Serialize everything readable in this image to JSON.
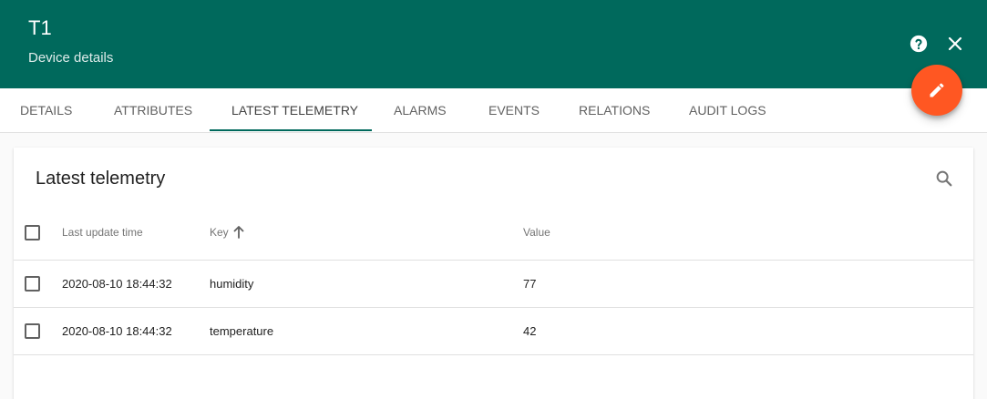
{
  "header": {
    "title": "T1",
    "subtitle": "Device details",
    "help_icon": "help-circle-icon",
    "close_icon": "close-icon",
    "background": "#00695c"
  },
  "fab": {
    "icon": "pencil-icon",
    "color": "#ff5722"
  },
  "tabs": [
    {
      "label": "DETAILS",
      "active": false
    },
    {
      "label": "ATTRIBUTES",
      "active": false
    },
    {
      "label": "LATEST TELEMETRY",
      "active": true
    },
    {
      "label": "ALARMS",
      "active": false
    },
    {
      "label": "EVENTS",
      "active": false
    },
    {
      "label": "RELATIONS",
      "active": false
    },
    {
      "label": "AUDIT LOGS",
      "active": false
    }
  ],
  "panel": {
    "title": "Latest telemetry",
    "search_icon": "search-icon",
    "columns": {
      "time": "Last update time",
      "key": "Key",
      "value": "Value",
      "sort_icon": "arrow-up-icon"
    },
    "rows": [
      {
        "time": "2020-08-10 18:44:32",
        "key": "humidity",
        "value": "77"
      },
      {
        "time": "2020-08-10 18:44:32",
        "key": "temperature",
        "value": "42"
      }
    ]
  }
}
